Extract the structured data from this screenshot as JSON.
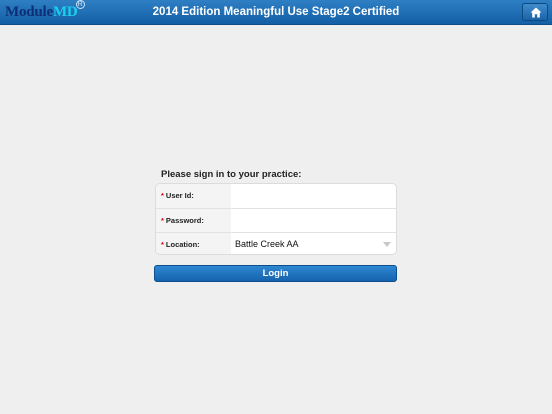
{
  "header": {
    "logo_module": "Module",
    "logo_md": "MD",
    "logo_reg": "R",
    "title": "2014 Edition Meaningful Use Stage2 Certified",
    "home_icon": "home-icon"
  },
  "login_form": {
    "prompt": "Please sign in to your practice:",
    "required_mark": "*",
    "fields": [
      {
        "label": "User Id:",
        "value": ""
      },
      {
        "label": "Password:",
        "value": ""
      },
      {
        "label": "Location:",
        "value": "Battle Creek AA",
        "icon": "chevron-down-icon"
      }
    ],
    "login_label": "Login"
  },
  "colors": {
    "header_blue": "#135fa5",
    "logo_dark": "#0e2f75",
    "logo_cyan": "#19d0f0",
    "required_red": "#d0021b",
    "background": "#efefef"
  }
}
